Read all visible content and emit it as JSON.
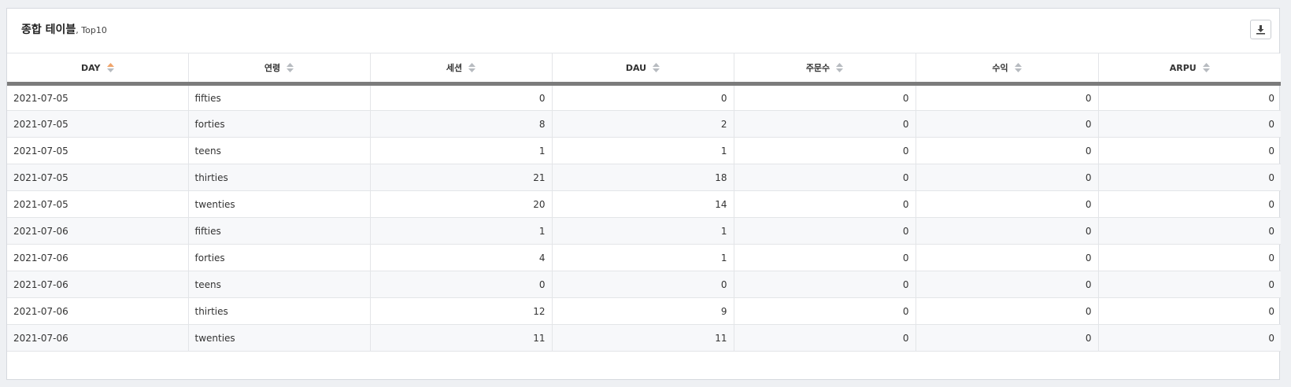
{
  "header": {
    "title": "종합 테이블",
    "subtitle": ", Top10",
    "download_icon": "download-icon"
  },
  "colors": {
    "sort_active": "#f0a46a",
    "sort_inactive": "#b7bbc0",
    "header_divider": "#7b7b7b",
    "stripe": "#f7f8fa"
  },
  "table": {
    "columns": [
      {
        "label": "DAY",
        "sort": "asc"
      },
      {
        "label": "연령",
        "sort": "none"
      },
      {
        "label": "세션",
        "sort": "none"
      },
      {
        "label": "DAU",
        "sort": "none"
      },
      {
        "label": "주문수",
        "sort": "none"
      },
      {
        "label": "수익",
        "sort": "none"
      },
      {
        "label": "ARPU",
        "sort": "none"
      }
    ],
    "rows": [
      [
        "2021-07-05",
        "fifties",
        "0",
        "0",
        "0",
        "0",
        "0"
      ],
      [
        "2021-07-05",
        "forties",
        "8",
        "2",
        "0",
        "0",
        "0"
      ],
      [
        "2021-07-05",
        "teens",
        "1",
        "1",
        "0",
        "0",
        "0"
      ],
      [
        "2021-07-05",
        "thirties",
        "21",
        "18",
        "0",
        "0",
        "0"
      ],
      [
        "2021-07-05",
        "twenties",
        "20",
        "14",
        "0",
        "0",
        "0"
      ],
      [
        "2021-07-06",
        "fifties",
        "1",
        "1",
        "0",
        "0",
        "0"
      ],
      [
        "2021-07-06",
        "forties",
        "4",
        "1",
        "0",
        "0",
        "0"
      ],
      [
        "2021-07-06",
        "teens",
        "0",
        "0",
        "0",
        "0",
        "0"
      ],
      [
        "2021-07-06",
        "thirties",
        "12",
        "9",
        "0",
        "0",
        "0"
      ],
      [
        "2021-07-06",
        "twenties",
        "11",
        "11",
        "0",
        "0",
        "0"
      ]
    ]
  }
}
